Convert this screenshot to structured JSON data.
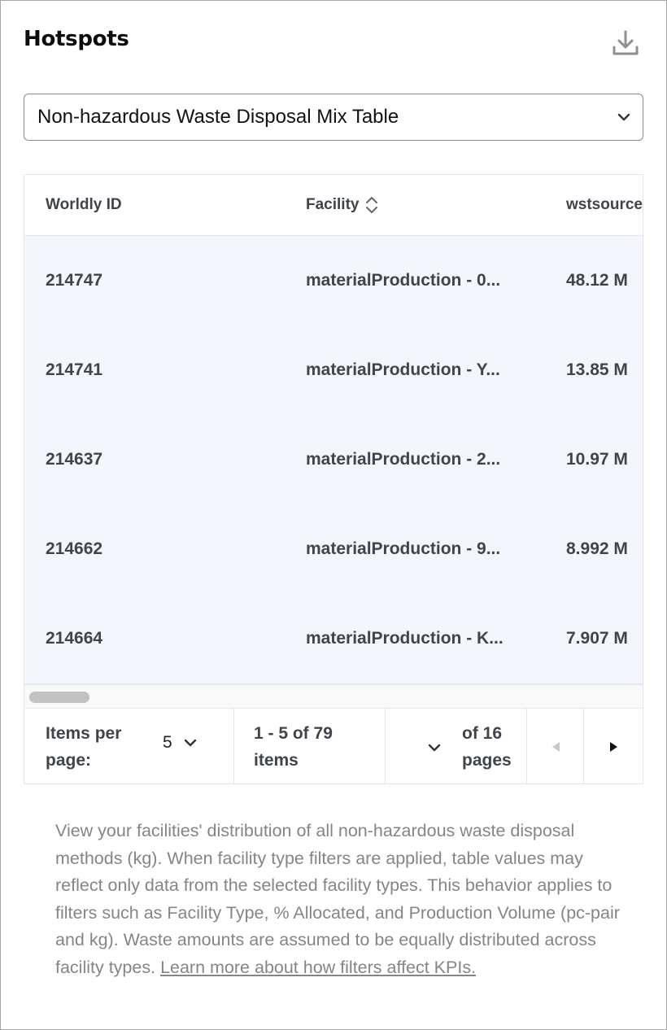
{
  "panel": {
    "title": "Hotspots",
    "download_icon": "download-icon"
  },
  "selector": {
    "value": "Non-hazardous Waste Disposal Mix Table",
    "chevron_icon": "chevron-down-icon"
  },
  "table": {
    "columns": [
      {
        "label": "Worldly ID"
      },
      {
        "label": "Facility",
        "sortable": true
      },
      {
        "label": "wstsource"
      }
    ],
    "rows": [
      {
        "id": "214747",
        "facility": "materialProduction - 0...",
        "value": "48.12 M"
      },
      {
        "id": "214741",
        "facility": "materialProduction - Y...",
        "value": "13.85 M"
      },
      {
        "id": "214637",
        "facility": "materialProduction - 2...",
        "value": "10.97 M"
      },
      {
        "id": "214662",
        "facility": "materialProduction - 9...",
        "value": "8.992 M"
      },
      {
        "id": "214664",
        "facility": "materialProduction - K...",
        "value": "7.907 M"
      }
    ]
  },
  "pagination": {
    "items_per_page_line1": "Items per",
    "items_per_page_line2": "page:",
    "items_per_page_value": "5",
    "range_line1": "1 - 5 of 79",
    "range_line2": "items",
    "pages_line1": "of 16",
    "pages_line2": "pages",
    "prev_icon": "caret-left-icon",
    "next_icon": "caret-right-icon"
  },
  "description": {
    "text": "View your facilities' distribution of all non-hazardous waste disposal methods (kg). When facility type filters are applied, table values may reflect only data from the selected facility types. This behavior applies to filters such as Facility Type, % Allocated, and Production Volume (pc-pair and kg). Waste amounts are assumed to be equally distributed across facility types.",
    "link_text": "Learn more about how filters affect KPIs."
  },
  "colors": {
    "row_background": "#f3f6fd",
    "border": "#e3e5e8",
    "muted_text": "#858585"
  }
}
